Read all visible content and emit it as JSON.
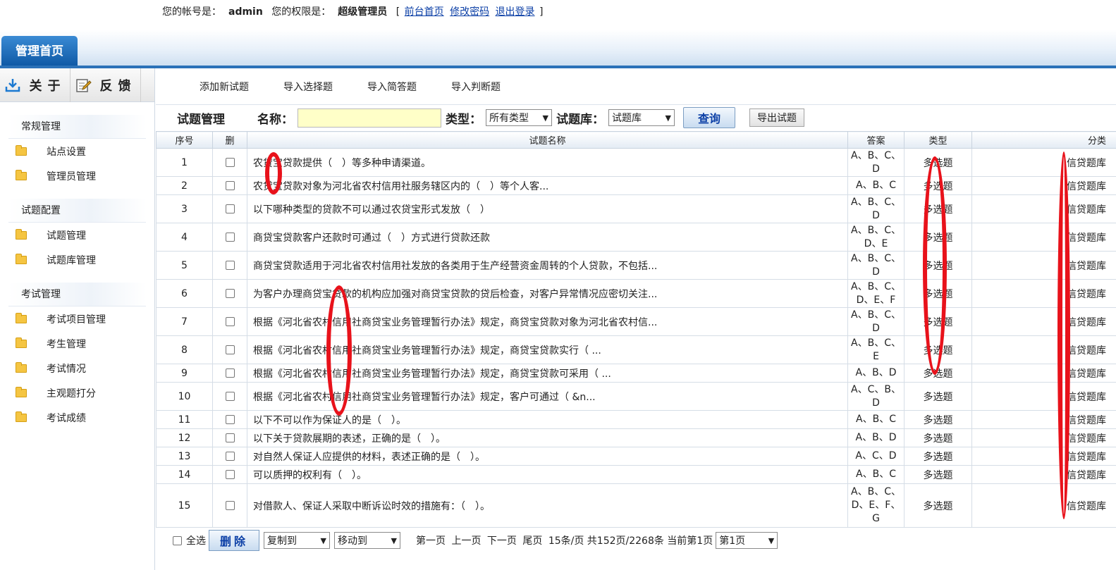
{
  "header": {
    "account_label": "您的帐号是：",
    "account_value": "admin",
    "perm_label": "您的权限是：",
    "perm_value": "超级管理员",
    "bracket_open": "[",
    "bracket_close": "]",
    "links": [
      "前台首页",
      "修改密码",
      "退出登录"
    ]
  },
  "tabs": {
    "home": "管理首页"
  },
  "sidebar": {
    "about": "关于",
    "feedback": "反馈",
    "groups": [
      {
        "title": "常规管理",
        "items": [
          "站点设置",
          "管理员管理"
        ]
      },
      {
        "title": "试题配置",
        "items": [
          "试题管理",
          "试题库管理"
        ]
      },
      {
        "title": "考试管理",
        "items": [
          "考试项目管理",
          "考生管理",
          "考试情况",
          "主观题打分",
          "考试成绩"
        ]
      }
    ]
  },
  "toolbar": [
    "添加新试题",
    "导入选择题",
    "导入简答题",
    "导入判断题"
  ],
  "search": {
    "title": "试题管理",
    "name_label": "名称：",
    "type_label": "类型：",
    "type_value": "所有类型",
    "bank_label": "试题库：",
    "bank_value": "试题库",
    "query_button": "查询",
    "export_button": "导出试题"
  },
  "table": {
    "headers": [
      "序号",
      "删",
      "试题名称",
      "答案",
      "类型",
      "分类"
    ],
    "rows": [
      {
        "no": "1",
        "name": "农贷宝贷款提供（　）等多种申请渠道。",
        "answer": "A、B、C、D",
        "type": "多选题",
        "category": "信贷题库"
      },
      {
        "no": "2",
        "name": "农贷宝贷款对象为河北省农村信用社服务辖区内的（　）等个人客...",
        "answer": "A、B、C",
        "type": "多选题",
        "category": "信贷题库"
      },
      {
        "no": "3",
        "name": "以下哪种类型的贷款不可以通过农贷宝形式发放（　）",
        "answer": "A、B、C、D",
        "type": "多选题",
        "category": "信贷题库"
      },
      {
        "no": "4",
        "name": "商贷宝贷款客户还款时可通过（　）方式进行贷款还款",
        "answer": "A、B、C、D、E",
        "type": "多选题",
        "category": "信贷题库"
      },
      {
        "no": "5",
        "name": "商贷宝贷款适用于河北省农村信用社发放的各类用于生产经营资金周转的个人贷款，不包括...",
        "answer": "A、B、C、D",
        "type": "多选题",
        "category": "信贷题库"
      },
      {
        "no": "6",
        "name": "为客户办理商贷宝贷款的机构应加强对商贷宝贷款的贷后检查，对客户异常情况应密切关注...",
        "answer": "A、B、C、D、E、F",
        "type": "多选题",
        "category": "信贷题库"
      },
      {
        "no": "7",
        "name": "根据《河北省农村信用社商贷宝业务管理暂行办法》规定，商贷宝贷款对象为河北省农村信...",
        "answer": "A、B、C、D",
        "type": "多选题",
        "category": "信贷题库"
      },
      {
        "no": "8",
        "name": "根据《河北省农村信用社商贷宝业务管理暂行办法》规定，商贷宝贷款实行（ ...",
        "answer": "A、B、C、E",
        "type": "多选题",
        "category": "信贷题库"
      },
      {
        "no": "9",
        "name": "根据《河北省农村信用社商贷宝业务管理暂行办法》规定，商贷宝贷款可采用（ ...",
        "answer": "A、B、D",
        "type": "多选题",
        "category": "信贷题库"
      },
      {
        "no": "10",
        "name": "根据《河北省农村信用社商贷宝业务管理暂行办法》规定，客户可通过（ &n...",
        "answer": "A、C、B、D",
        "type": "多选题",
        "category": "信贷题库"
      },
      {
        "no": "11",
        "name": "以下不可以作为保证人的是（　）。",
        "answer": "A、B、C",
        "type": "多选题",
        "category": "信贷题库"
      },
      {
        "no": "12",
        "name": "以下关于贷款展期的表述，正确的是（　）。",
        "answer": "A、B、D",
        "type": "多选题",
        "category": "信贷题库"
      },
      {
        "no": "13",
        "name": "对自然人保证人应提供的材料，表述正确的是（　）。",
        "answer": "A、C、D",
        "type": "多选题",
        "category": "信贷题库"
      },
      {
        "no": "14",
        "name": "可以质押的权利有（　）。",
        "answer": "A、B、C",
        "type": "多选题",
        "category": "信贷题库"
      },
      {
        "no": "15",
        "name": "对借款人、保证人采取中断诉讼时效的措施有：（　）。",
        "answer": "A、B、C、D、E、F、G",
        "type": "多选题",
        "category": "信贷题库"
      }
    ]
  },
  "footer": {
    "select_all": "全选",
    "delete_button": "删除",
    "copy_to": "复制到",
    "move_to": "移动到",
    "first": "第一页",
    "prev": "上一页",
    "next": "下一页",
    "last": "尾页",
    "summary": "15条/页 共152页/2268条 当前第1页",
    "page_select": "第1页"
  },
  "colors": {
    "accent": "#0f5aa6",
    "annotation": "#e8121b",
    "input_bg": "#ffffc8"
  }
}
